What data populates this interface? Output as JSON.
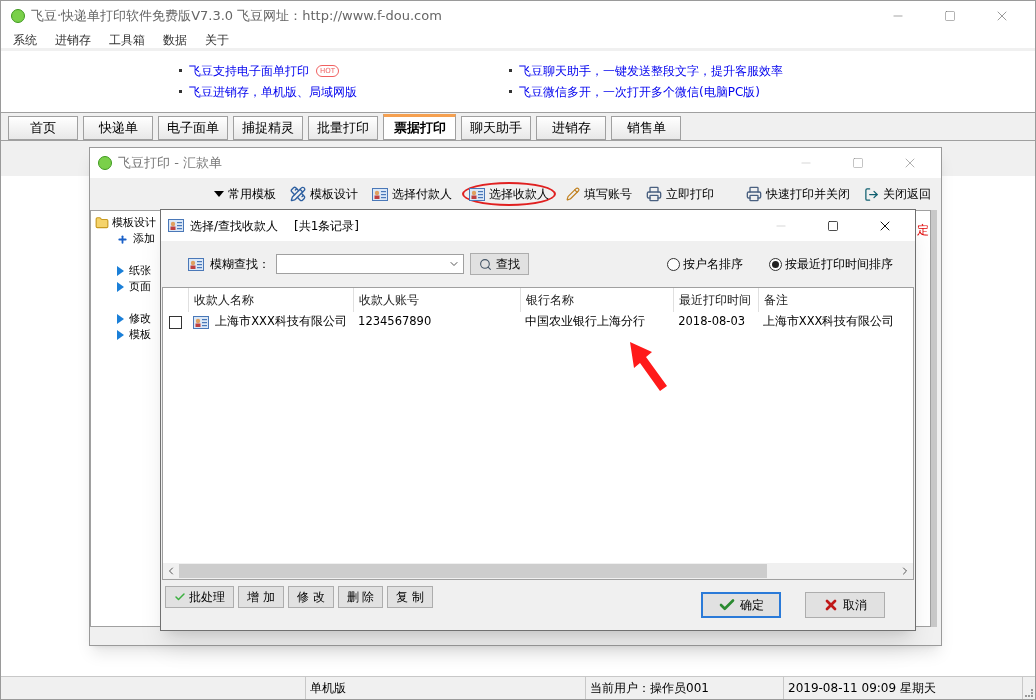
{
  "window": {
    "title": "飞豆·快递单打印软件免费版V7.3.0  飞豆网址：http://www.f-dou.com"
  },
  "menu": [
    "系统",
    "进销存",
    "工具箱",
    "数据",
    "关于"
  ],
  "banner": {
    "columns": [
      [
        {
          "text": "飞豆支持电子面单打印",
          "badge": "HOT"
        },
        {
          "text": "飞豆进销存，单机版、局域网版"
        }
      ],
      [
        {
          "text": "飞豆聊天助手，一键发送整段文字，提升客服效率"
        },
        {
          "text": "飞豆微信多开，一次打开多个微信(电脑PC版)"
        }
      ]
    ]
  },
  "tabs": [
    {
      "label": "首页",
      "selected": false
    },
    {
      "label": "快递单",
      "selected": false
    },
    {
      "label": "电子面单",
      "selected": false
    },
    {
      "label": "捕捉精灵",
      "selected": false
    },
    {
      "label": "批量打印",
      "selected": false
    },
    {
      "label": "票据打印",
      "selected": true
    },
    {
      "label": "聊天助手",
      "selected": false
    },
    {
      "label": "进销存",
      "selected": false
    },
    {
      "label": "销售单",
      "selected": false
    }
  ],
  "child_window": {
    "title": "飞豆打印 - 汇款单",
    "toolbar": [
      {
        "label": "常用模板",
        "kind": "dropdown",
        "highlighted": false
      },
      {
        "label": "模板设计",
        "kind": "design",
        "highlighted": false
      },
      {
        "label": "选择付款人",
        "kind": "contact",
        "highlighted": false
      },
      {
        "label": "选择收款人",
        "kind": "contact",
        "highlighted": true
      },
      {
        "label": "填写账号",
        "kind": "edit",
        "highlighted": false
      },
      {
        "label": "立即打印",
        "kind": "print",
        "highlighted": false
      },
      {
        "label": "快速打印并关闭",
        "kind": "print",
        "highlighted": false
      },
      {
        "label": "关闭返回",
        "kind": "exit",
        "highlighted": false
      }
    ],
    "tree": {
      "label": "模板设计",
      "groups": [
        [
          {
            "label": "添加",
            "kind": "add"
          }
        ],
        [
          {
            "label": "纸张",
            "kind": "arrow"
          },
          {
            "label": "页面",
            "kind": "arrow"
          }
        ],
        [
          {
            "label": "修改",
            "kind": "arrow"
          },
          {
            "label": "模板",
            "kind": "arrow"
          }
        ]
      ]
    },
    "side_text": "定"
  },
  "dialog": {
    "title": "选择/查找收款人",
    "count": "[共1条记录]",
    "search_label": "模糊查找：",
    "search_button": "查找",
    "sort_options": [
      {
        "label": "按户名排序",
        "selected": false
      },
      {
        "label": "按最近打印时间排序",
        "selected": true
      }
    ],
    "columns": [
      "收款人名称",
      "收款人账号",
      "银行名称",
      "最近打印时间",
      "备注"
    ],
    "rows": [
      {
        "checked": false,
        "cells": [
          "上海市XXX科技有限公司",
          "1234567890",
          "中国农业银行上海分行",
          "2018-08-03",
          "上海市XXX科技有限公司"
        ]
      }
    ],
    "actions": [
      "批处理",
      "增 加",
      "修 改",
      "删 除",
      "复 制"
    ],
    "ok": "确定",
    "cancel": "取消"
  },
  "status_bar": [
    "单机版",
    "当前用户：操作员001",
    "2019-08-11 09:09 星期天"
  ]
}
